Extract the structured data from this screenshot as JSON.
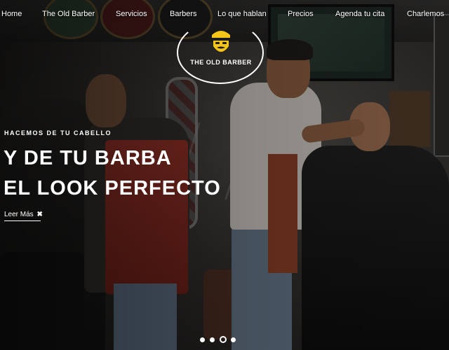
{
  "nav": {
    "items": [
      {
        "label": "Home"
      },
      {
        "label": "The Old Barber"
      },
      {
        "label": "Servicios"
      },
      {
        "label": "Barbers"
      },
      {
        "label": "Lo que hablan"
      },
      {
        "label": "Precios"
      },
      {
        "label": "Agenda tu cita"
      },
      {
        "label": "Charlemos"
      }
    ]
  },
  "logo": {
    "text": "THE OLD BARBER",
    "badge_color": "#f5c518",
    "icon": "barber-face-icon"
  },
  "hero": {
    "kicker": "HACEMOS DE TU CABELLO",
    "line1": "Y DE TU BARBA",
    "line2": "EL LOOK PERFECTO",
    "read_more": "Leer Más",
    "read_more_icon": "scissors-cross-icon"
  },
  "slider": {
    "slide_count": 4,
    "active_index": 2
  },
  "colors": {
    "text": "#ffffff",
    "accent": "#f5c518"
  }
}
